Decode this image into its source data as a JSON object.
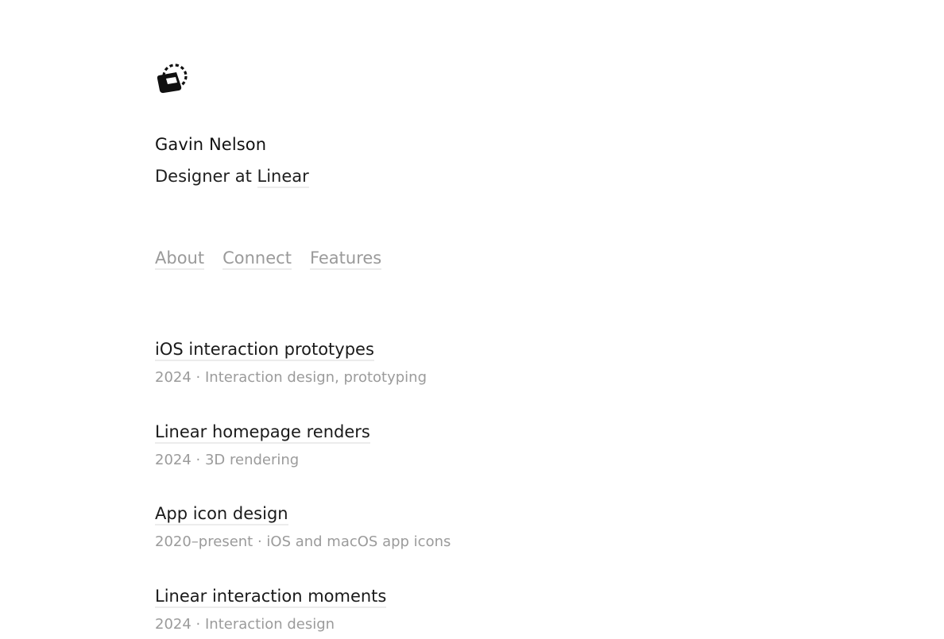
{
  "profile": {
    "name": "Gavin Nelson",
    "role_prefix": "Designer at ",
    "role_company": "Linear",
    "logo_icon": "dashed-circle-cube-icon"
  },
  "nav": {
    "items": [
      {
        "label": "About"
      },
      {
        "label": "Connect"
      },
      {
        "label": "Features"
      }
    ]
  },
  "projects": [
    {
      "title": "iOS interaction prototypes",
      "meta": "2024 · Interaction design, prototyping"
    },
    {
      "title": "Linear homepage renders",
      "meta": "2024 · 3D rendering"
    },
    {
      "title": "App icon design",
      "meta": "2020–present · iOS and macOS app icons"
    },
    {
      "title": "Linear interaction moments",
      "meta": "2024 · Interaction design"
    }
  ],
  "colors": {
    "text_primary": "#1a1a1a",
    "text_muted": "#9a9a9a",
    "underline": "#ececec",
    "background": "#ffffff"
  }
}
